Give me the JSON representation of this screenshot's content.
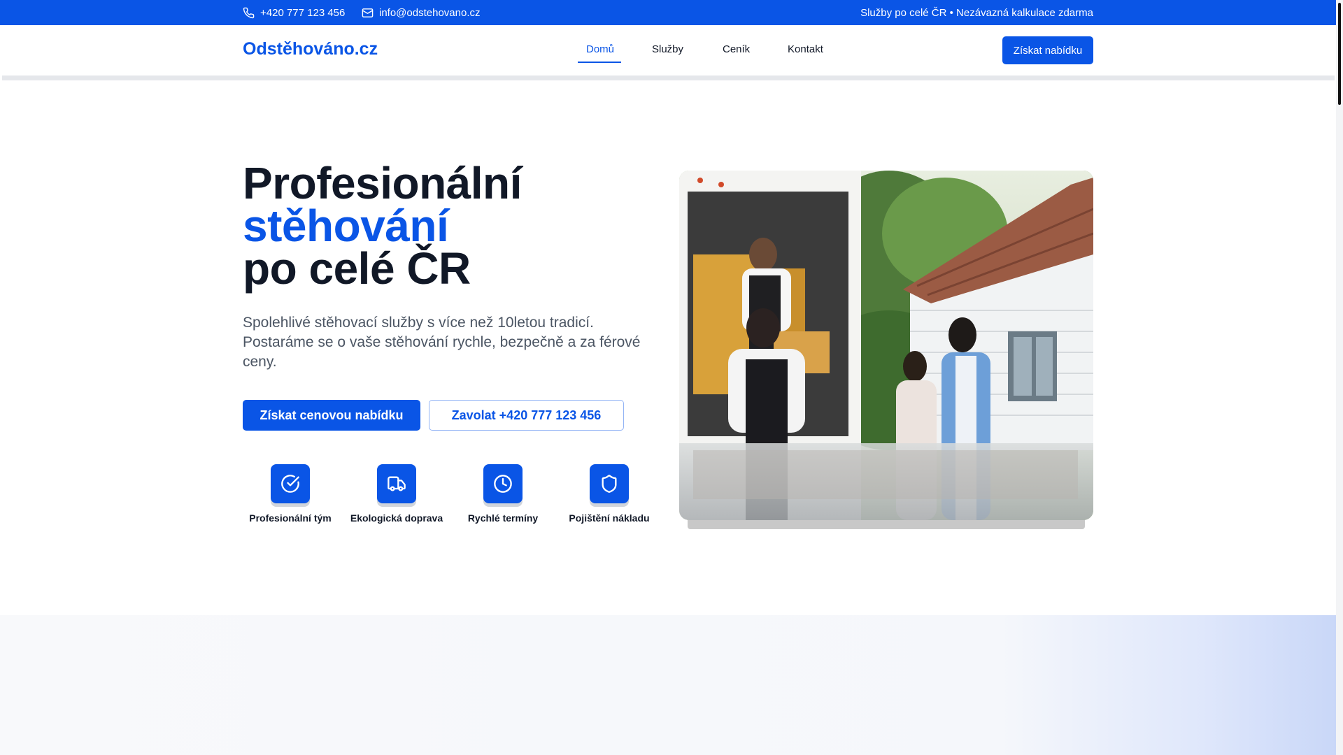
{
  "topbar": {
    "phone": "+420 777 123 456",
    "email": "info@odstehovano.cz",
    "tagline": "Služby po celé ČR • Nezávazná kalkulace zdarma",
    "phone_icon": "phone-icon",
    "email_icon": "mail-icon"
  },
  "header": {
    "logo": "Odstěhováno.cz",
    "nav": [
      {
        "label": "Domů",
        "active": true
      },
      {
        "label": "Služby",
        "active": false
      },
      {
        "label": "Ceník",
        "active": false
      },
      {
        "label": "Kontakt",
        "active": false
      }
    ],
    "cta": "Získat nabídku"
  },
  "hero": {
    "title_line1": "Profesionální",
    "title_line2": "stěhování",
    "title_line3": "po celé ČR",
    "subtitle": "Spolehlivé stěhovací služby s více než 10letou tradicí. Postaráme se o vaše stěhování rychle, bezpečně a za férové ceny.",
    "primary_button": "Získat cenovou nabídku",
    "secondary_button": "Zavolat +420 777 123 456",
    "features": [
      {
        "label": "Profesionální tým",
        "icon": "check-circle-icon"
      },
      {
        "label": "Ekologická doprava",
        "icon": "truck-icon"
      },
      {
        "label": "Rychlé termíny",
        "icon": "clock-icon"
      },
      {
        "label": "Pojištění nákladu",
        "icon": "shield-icon"
      }
    ]
  },
  "colors": {
    "brand": "#0a55e6",
    "text": "#111827",
    "muted": "#4b5563"
  }
}
